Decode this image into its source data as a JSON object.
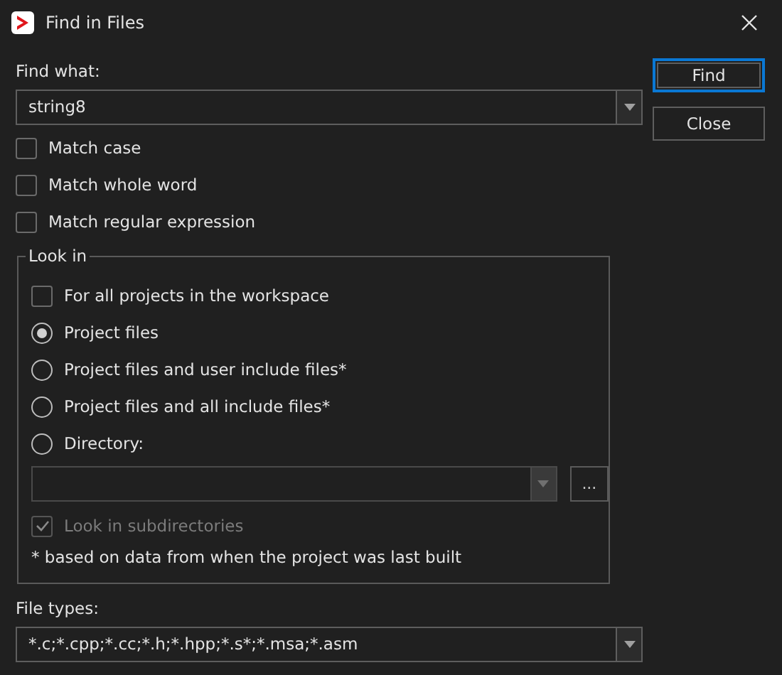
{
  "window": {
    "title": "Find in Files"
  },
  "find_what": {
    "label": "Find what:",
    "value": "string8"
  },
  "options": [
    {
      "label": "Match case",
      "checked": false
    },
    {
      "label": "Match whole word",
      "checked": false
    },
    {
      "label": "Match regular expression",
      "checked": false
    }
  ],
  "look_in": {
    "title": "Look in",
    "items": [
      {
        "kind": "checkbox",
        "label": "For all projects in the workspace",
        "checked": false
      },
      {
        "kind": "radio",
        "label": "Project files",
        "selected": true
      },
      {
        "kind": "radio",
        "label": "Project files and user include files*",
        "selected": false
      },
      {
        "kind": "radio",
        "label": "Project files and all include files*",
        "selected": false
      },
      {
        "kind": "radio",
        "label": "Directory:",
        "selected": false
      }
    ],
    "directory": {
      "disabled": true
    },
    "browse_button": "...",
    "subdirectories": {
      "label": "Look in subdirectories",
      "checked": true,
      "disabled": true
    },
    "note": "* based on data from when the project was last built"
  },
  "file_types": {
    "label": "File types:",
    "value": "*.c;*.cpp;*.cc;*.h;*.hpp;*.s*;*.msa;*.asm"
  },
  "buttons": [
    {
      "label": "Find",
      "default": true
    },
    {
      "label": "Close",
      "default": false
    }
  ]
}
